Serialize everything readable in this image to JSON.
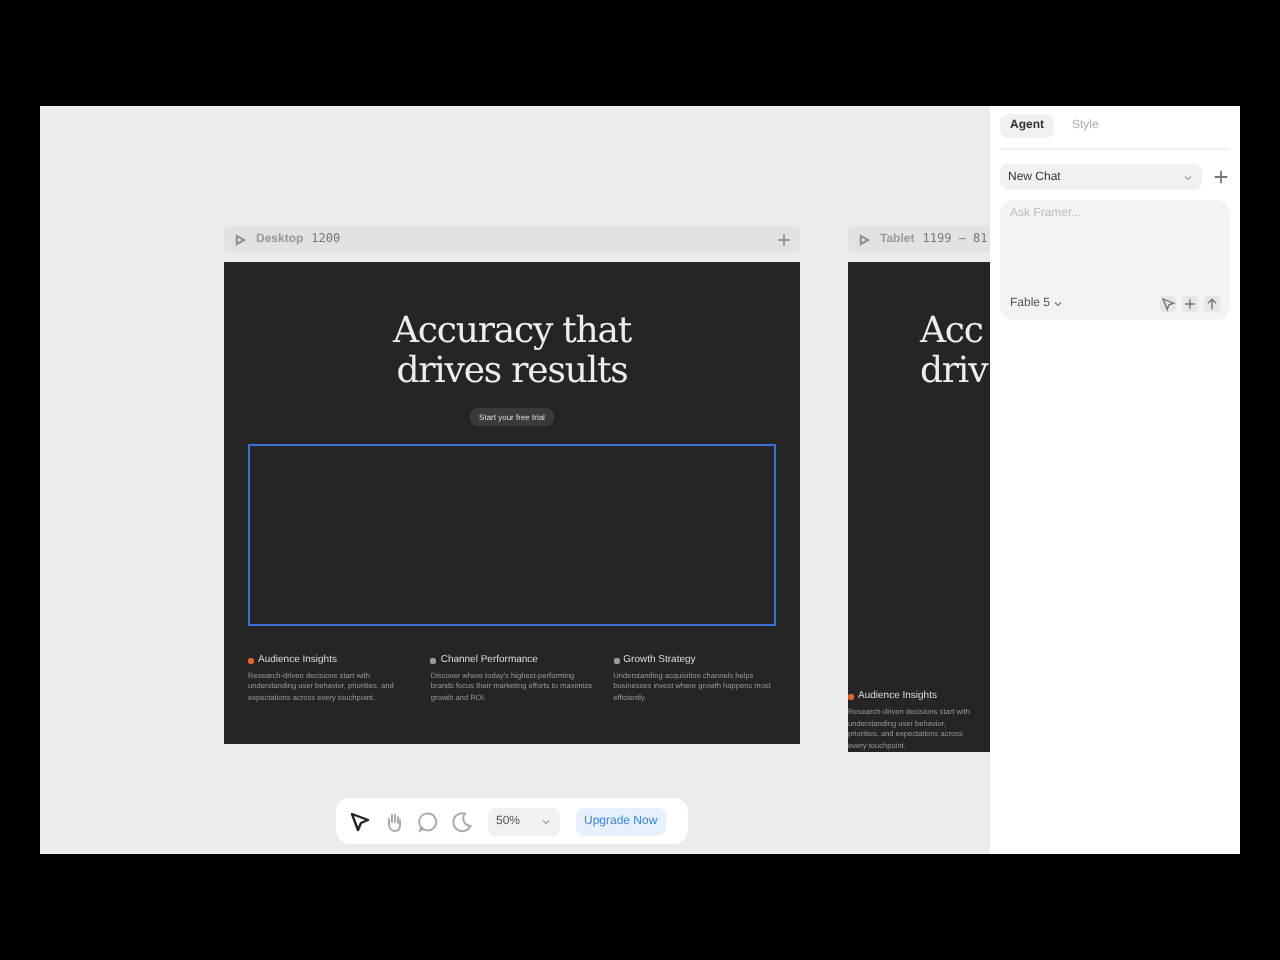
{
  "frames": [
    {
      "kind": "desktop",
      "name": "Desktop",
      "size": "1200",
      "heading": [
        "Accuracy that",
        "drives results"
      ],
      "cta": "Start your free trial",
      "selection": true,
      "features": [
        {
          "title": "Audience Insights",
          "color": "#e8622c",
          "text": "Research-driven decisions start with understanding user behavior, priorities, and expectations across every touchpoint."
        },
        {
          "title": "Channel Performance",
          "color": "#9a9a9a",
          "text": "Discover where today's highest-performing brands focus their marketing efforts to maximize growth and ROI."
        },
        {
          "title": "Growth Strategy",
          "color": "#9a9a9a",
          "text": "Understanding acquisition channels helps businesses invest where growth happens most efficiently."
        }
      ]
    },
    {
      "kind": "tablet",
      "name": "Tablet",
      "size": "1199 — 81",
      "heading": [
        "Acc",
        "driv"
      ],
      "selection": false,
      "features": [
        {
          "title": "Audience Insights",
          "color": "#e8622c",
          "text": "Research-driven decisions start with understanding user behavior, priorities, and expectations across every touchpoint."
        }
      ]
    }
  ],
  "toolbar": {
    "tools": [
      {
        "kind": "pointer",
        "selected": true
      },
      {
        "kind": "hand",
        "selected": false
      },
      {
        "kind": "comment",
        "selected": false
      },
      {
        "kind": "moon",
        "selected": false
      }
    ],
    "zoom": "50%",
    "upgrade": "Upgrade Now"
  },
  "panel": {
    "tabs": [
      {
        "label": "Agent",
        "selected": true
      },
      {
        "label": "Style",
        "selected": false
      }
    ],
    "chat": "New Chat",
    "prompt": {
      "placeholder": "Ask Framer..."
    },
    "model": "Fable 5"
  }
}
